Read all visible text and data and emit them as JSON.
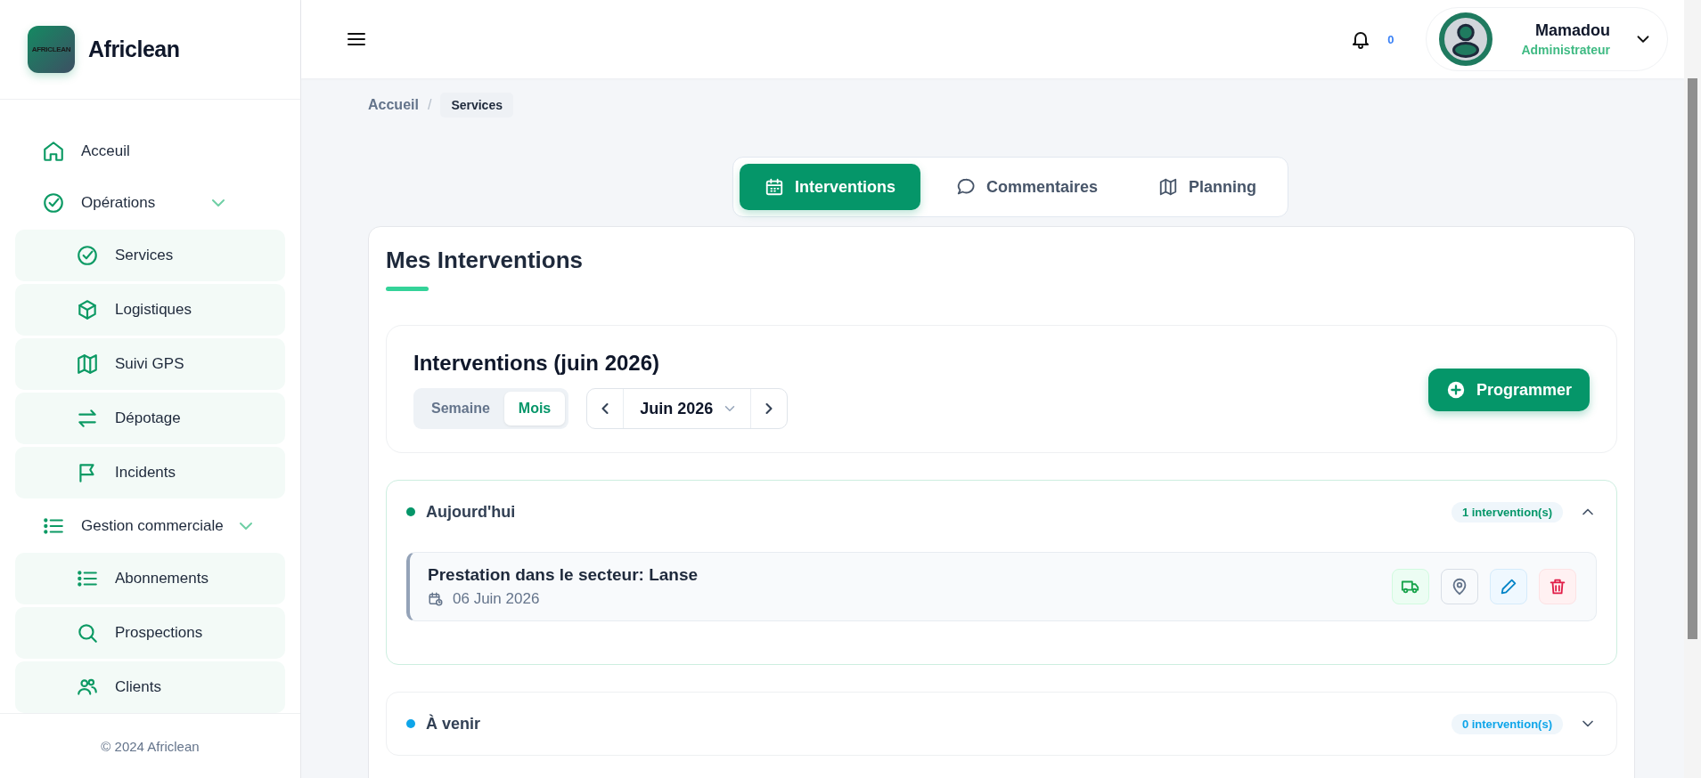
{
  "brand": {
    "logo_text": "AFRICLEAN",
    "name": "Africlean"
  },
  "sidebar": {
    "items": [
      {
        "label": "Acceuil"
      },
      {
        "label": "Opérations",
        "expanded": true,
        "children": [
          {
            "label": "Services"
          },
          {
            "label": "Logistiques"
          },
          {
            "label": "Suivi GPS"
          },
          {
            "label": "Dépotage"
          },
          {
            "label": "Incidents"
          }
        ]
      },
      {
        "label": "Gestion commerciale",
        "expanded": true,
        "children": [
          {
            "label": "Abonnements"
          },
          {
            "label": "Prospections"
          },
          {
            "label": "Clients"
          }
        ]
      }
    ],
    "footer": "© 2024 Africlean"
  },
  "topbar": {
    "notification_count": "0",
    "user": {
      "name": "Mamadou",
      "role": "Administrateur"
    }
  },
  "breadcrumb": [
    "Accueil",
    "/",
    "Services"
  ],
  "tabs": [
    {
      "label": "Interventions",
      "selected": true
    },
    {
      "label": "Commentaires",
      "selected": false
    },
    {
      "label": "Planning",
      "selected": false
    }
  ],
  "page_title": "Mes Interventions",
  "toolbar": {
    "title": "Interventions (juin 2026)",
    "views": [
      {
        "label": "Semaine",
        "selected": false
      },
      {
        "label": "Mois",
        "selected": true
      }
    ],
    "period": "Juin 2026",
    "action": "Programmer"
  },
  "sections": [
    {
      "title": "Aujourd'hui",
      "color": "#059669",
      "count": "1 intervention(s)",
      "expanded": true,
      "items": [
        {
          "title": "Prestation dans le secteur: Lanse",
          "date": "06 Juin 2026"
        }
      ]
    },
    {
      "title": "À venir",
      "color": "#0ea5e9",
      "count": "0 intervention(s)",
      "expanded": false
    }
  ]
}
